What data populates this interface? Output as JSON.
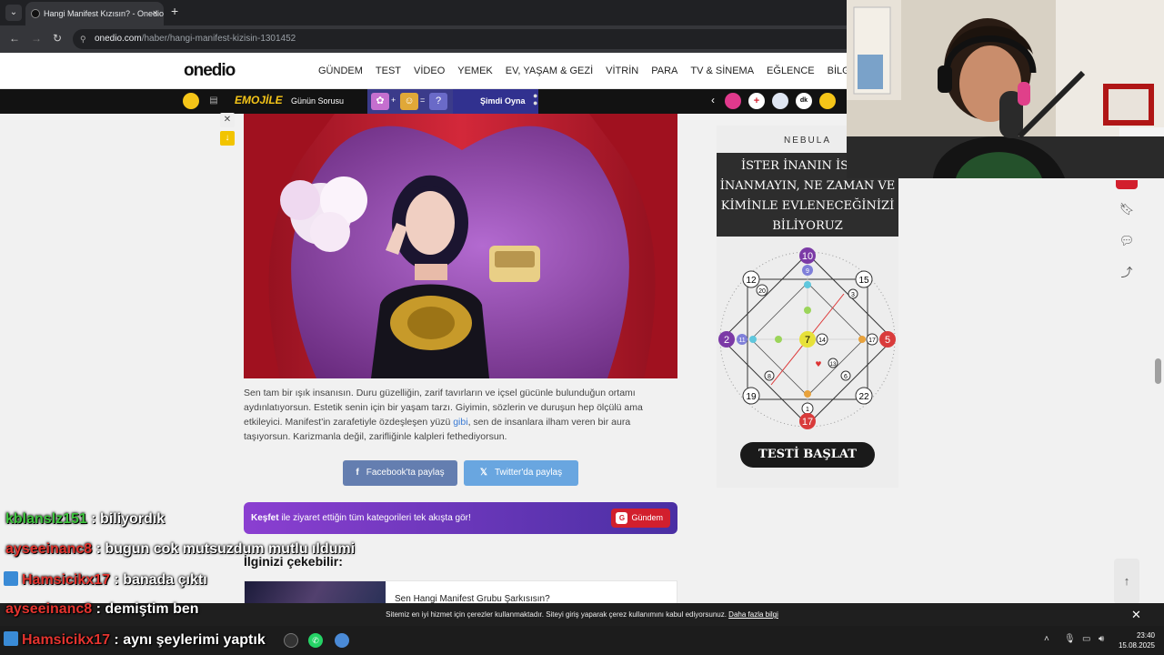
{
  "browser": {
    "tab_title": "Hangi Manifest Kızısın? - Onedio",
    "url_host": "onedio.com",
    "url_path": "/haber/hangi-manifest-kizisin-1301452"
  },
  "site": {
    "logo": "onedio",
    "nav": [
      "GÜNDEM",
      "TEST",
      "VİDEO",
      "YEMEK",
      "EV, YAŞAM & GEZİ",
      "VİTRİN",
      "PARA",
      "TV & SİNEMA",
      "EĞLENCE",
      "BİLGİSEL"
    ]
  },
  "gamestrip": {
    "game_name": "EMOJİLE",
    "question_label": "Günün Sorusu",
    "puzzle": [
      "+",
      "=",
      "?"
    ],
    "play_label": "Şimdi Oyna",
    "chevron": "‹",
    "badges": [
      "+",
      "dk"
    ]
  },
  "article": {
    "paragraph_before_link": "Sen tam bir ışık insanısın. Duru güzelliğin, zarif tavırların ve içsel gücünle bulunduğun ortamı aydınlatıyorsun. Estetik senin için bir yaşam tarzı. Giyimin, sözlerin ve duruşun hep ölçülü ama etkileyici. Manifest'in zarafetiyle özdeşleşen yüzü ",
    "link_text": "gibi",
    "paragraph_after_link": ", sen de insanlara ilham veren bir aura taşıyorsun. Karizmanla değil, zarifliğinle kalpleri fethediyorsun.",
    "share_facebook": "Facebook'ta paylaş",
    "share_twitter": "Twitter'da paylaş",
    "discover_bold": "Keşfet",
    "discover_text": " ile ziyaret ettiğin tüm kategorileri tek akışta gör!",
    "discover_button": "Gündem",
    "related_heading": "İlginizi çekebilir:",
    "related_item_title": "Sen Hangi Manifest Grubu Şarkısısın?"
  },
  "ad": {
    "brand": "NEBULA",
    "headline": [
      "İSTER İNANIN İSTER",
      "İNANMAYIN, NE ZAMAN VE",
      "KİMİNLE EVLENECEĞİNİZİ",
      "BİLİYORUZ"
    ],
    "cta": "TESTİ BAŞLAT",
    "numbers": [
      "10",
      "9",
      "12",
      "15",
      "20",
      "3",
      "2",
      "11",
      "7",
      "14",
      "5",
      "17",
      "19",
      "22",
      "1",
      "17",
      "8",
      "6",
      "13"
    ]
  },
  "cookie": {
    "text": "Sitemiz en iyi hizmet için çerezler kullanmaktadır. Siteyi giriş yaparak çerez kullanımını kabul ediyorsunuz. ",
    "link": "Daha fazla bilgi",
    "close": "✕"
  },
  "chat": [
    {
      "user": "kblanslz151",
      "message": " : biliyordık",
      "color": "#3ec43e"
    },
    {
      "user": "ayseeinanc8",
      "message": " : bugun cok mutsuzdum mutlu ıldumi",
      "color": "#e3342f"
    },
    {
      "user": "Hamsicikx17",
      "message": " : banada çıktı",
      "color": "#e3342f"
    },
    {
      "user": "ayseeinanc8",
      "message": " : demiştim ben",
      "color": "#e3342f"
    },
    {
      "user": "Hamsicikx17",
      "message": " : aynı şeylerimi yaptık",
      "color": "#e3342f"
    }
  ],
  "taskbar": {
    "time": "23:40",
    "date": "15.08.2025"
  },
  "colors": {
    "accent_red": "#d21f2d",
    "discover_gradient_start": "#8b3fd1",
    "discover_gradient_end": "#4a2fa3",
    "facebook": "#4c6ba5",
    "twitter": "#69a6e0"
  }
}
